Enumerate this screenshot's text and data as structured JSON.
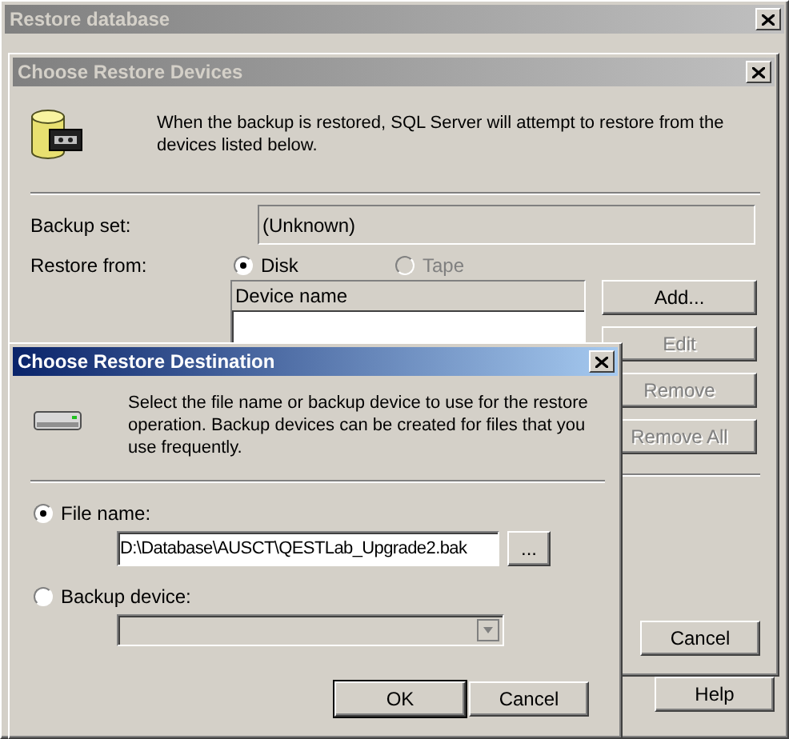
{
  "main_window": {
    "title": "Restore database",
    "active": false,
    "buttons": [
      {
        "label": "Help"
      }
    ]
  },
  "devices_dialog": {
    "title": "Choose Restore Devices",
    "active": false,
    "message": "When the backup is restored, SQL Server will attempt to restore from the devices listed below.",
    "backup_set": {
      "label": "Backup set:",
      "value": "(Unknown)"
    },
    "restore_from": {
      "label": "Restore from:",
      "options": [
        {
          "label": "Disk",
          "selected": true,
          "disabled": false
        },
        {
          "label": "Tape",
          "selected": false,
          "disabled": true
        }
      ]
    },
    "device_list": {
      "column": "Device name"
    },
    "buttons": [
      {
        "label": "Add...",
        "disabled": false
      },
      {
        "label": "Edit",
        "disabled": true
      },
      {
        "label": "Remove",
        "disabled": true
      },
      {
        "label": "Remove All",
        "disabled": true
      }
    ],
    "footer_buttons": [
      {
        "label": "Cancel"
      }
    ]
  },
  "destination_dialog": {
    "title": "Choose Restore Destination",
    "active": true,
    "message": "Select the file name or backup device to use for the restore operation.  Backup devices can be created for files that you use frequently.",
    "options": [
      {
        "kind": "file",
        "label": "File name:",
        "selected": true,
        "field_disabled": false,
        "value": "D:\\Database\\AUSCT\\QESTLab_Upgrade2.bak",
        "browse": "..."
      },
      {
        "kind": "device",
        "label": "Backup device:",
        "selected": false,
        "field_disabled": true
      }
    ],
    "buttons": [
      {
        "label": "OK",
        "default": true
      },
      {
        "label": "Cancel",
        "default": false
      }
    ]
  }
}
